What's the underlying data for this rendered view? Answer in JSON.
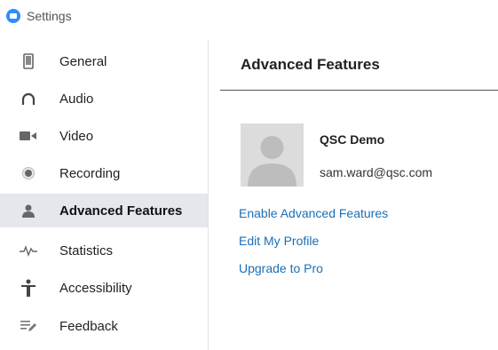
{
  "window": {
    "title": "Settings"
  },
  "sidebar": {
    "items": [
      {
        "label": "General",
        "icon": "phone-icon"
      },
      {
        "label": "Audio",
        "icon": "headphones-icon"
      },
      {
        "label": "Video",
        "icon": "video-camera-icon"
      },
      {
        "label": "Recording",
        "icon": "record-icon"
      },
      {
        "label": "Advanced Features",
        "icon": "user-icon",
        "active": true
      },
      {
        "label": "Statistics",
        "icon": "pulse-icon"
      },
      {
        "label": "Accessibility",
        "icon": "accessibility-icon"
      },
      {
        "label": "Feedback",
        "icon": "feedback-icon"
      }
    ]
  },
  "main": {
    "title": "Advanced Features",
    "profile": {
      "name": "QSC Demo",
      "email": "sam.ward@qsc.com"
    },
    "links": [
      "Enable Advanced Features",
      "Edit My Profile",
      "Upgrade to Pro"
    ]
  },
  "colors": {
    "accent": "#2D8CFF",
    "link": "#1B6FB5",
    "active_bg": "#E4E7EC"
  }
}
